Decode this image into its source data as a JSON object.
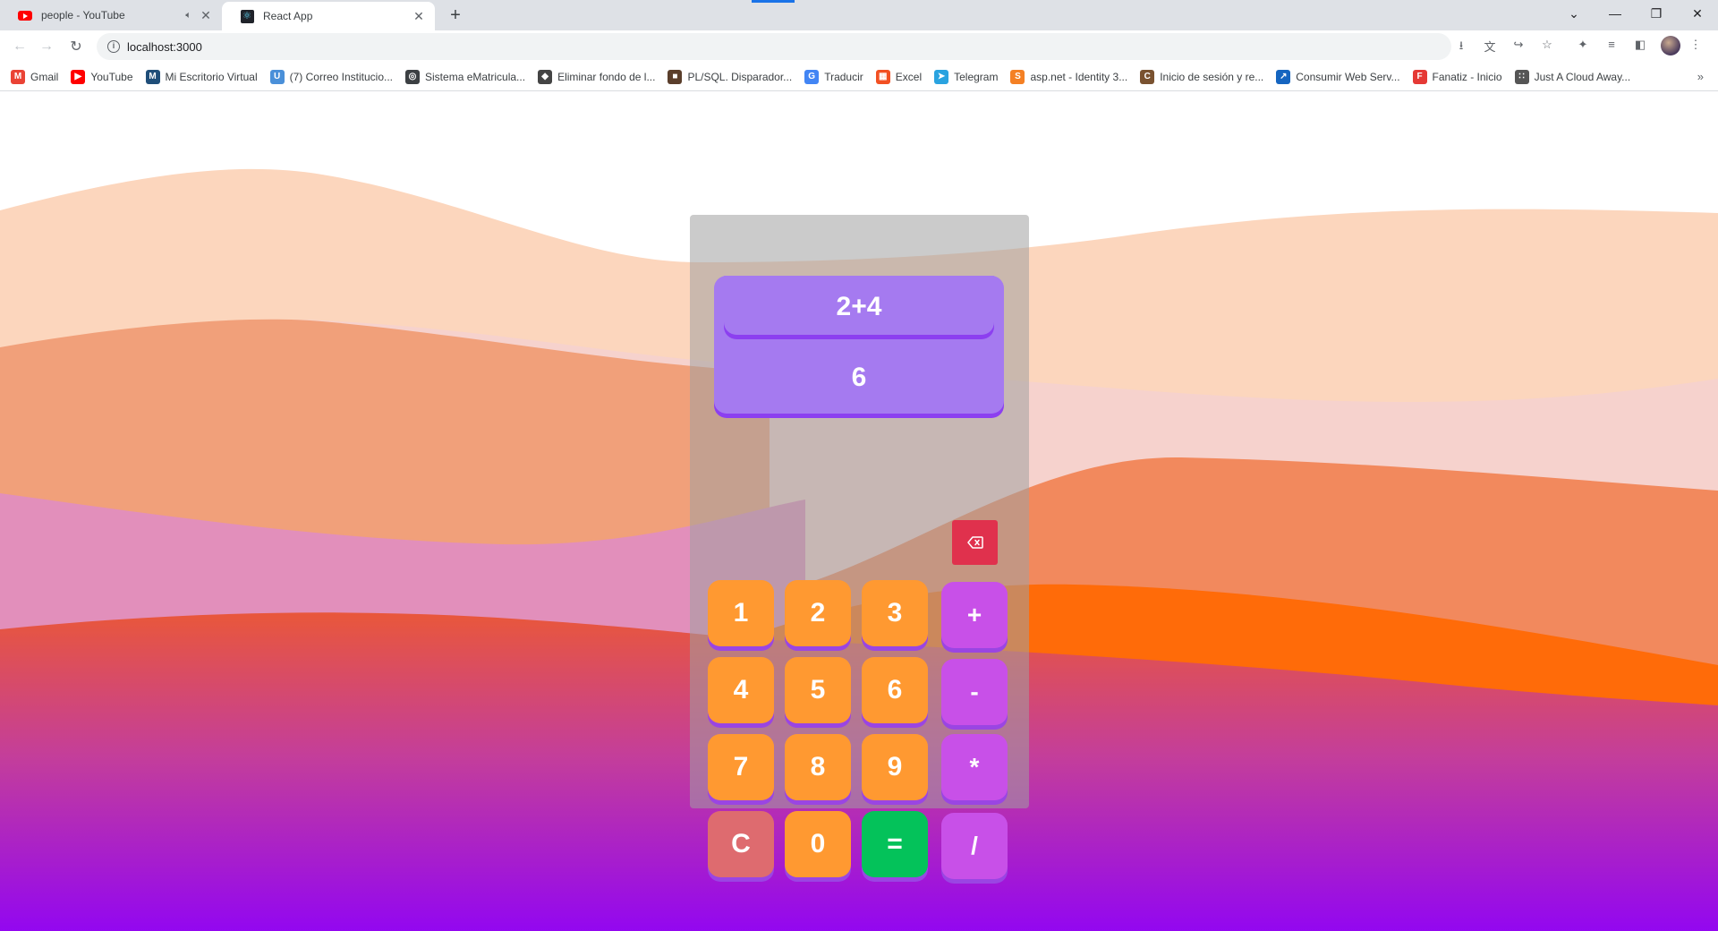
{
  "browser": {
    "tabs": [
      {
        "title": "people - YouTube",
        "favicon": "youtube-icon",
        "audio": true
      },
      {
        "title": "React App",
        "favicon": "react-icon",
        "active": true
      }
    ],
    "new_tab_label": "+",
    "address": "localhost:3000",
    "bookmarks": [
      {
        "label": "Gmail",
        "icon": "gmail-icon",
        "color": "#ea4335"
      },
      {
        "label": "YouTube",
        "icon": "youtube-icon",
        "color": "#ff0000"
      },
      {
        "label": "Mi Escritorio Virtual",
        "icon": "m-icon",
        "color": "#1f4e79"
      },
      {
        "label": "(7) Correo Institucio...",
        "icon": "ucr-icon",
        "color": "#4a90d9"
      },
      {
        "label": "Sistema eMatricula...",
        "icon": "globe-icon",
        "color": "#3c4043"
      },
      {
        "label": "Eliminar fondo de l...",
        "icon": "layers-icon",
        "color": "#444444"
      },
      {
        "label": "PL/SQL. Disparador...",
        "icon": "folder-icon",
        "color": "#5a3e2b"
      },
      {
        "label": "Traducir",
        "icon": "translate-icon",
        "color": "#4285f4"
      },
      {
        "label": "Excel",
        "icon": "microsoft-icon",
        "color": "#f25022"
      },
      {
        "label": "Telegram",
        "icon": "telegram-icon",
        "color": "#2aa3e0"
      },
      {
        "label": "asp.net - Identity 3...",
        "icon": "stackoverflow-icon",
        "color": "#f48024"
      },
      {
        "label": "Inicio de sesión y re...",
        "icon": "coursera-icon",
        "color": "#7a5230"
      },
      {
        "label": "Consumir Web Serv...",
        "icon": "web-service-icon",
        "color": "#1565c0"
      },
      {
        "label": "Fanatiz - Inicio",
        "icon": "fanatiz-icon",
        "color": "#e53935"
      },
      {
        "label": "Just A Cloud Away...",
        "icon": "chart-icon",
        "color": "#555555"
      }
    ]
  },
  "calculator": {
    "expression": "2+4",
    "result": "6",
    "keys": {
      "k1": "1",
      "k2": "2",
      "k3": "3",
      "plus": "+",
      "k4": "4",
      "k5": "5",
      "k6": "6",
      "minus": "-",
      "k7": "7",
      "k8": "8",
      "k9": "9",
      "multiply": "*",
      "clear": "C",
      "k0": "0",
      "equals": "=",
      "divide": "/"
    }
  },
  "colors": {
    "display": "#a57af0",
    "number_key": "#ff9931",
    "operator_key": "#c850e8",
    "clear_key": "#de6b6f",
    "equals_key": "#04c25a",
    "backspace": "#e0314d"
  }
}
